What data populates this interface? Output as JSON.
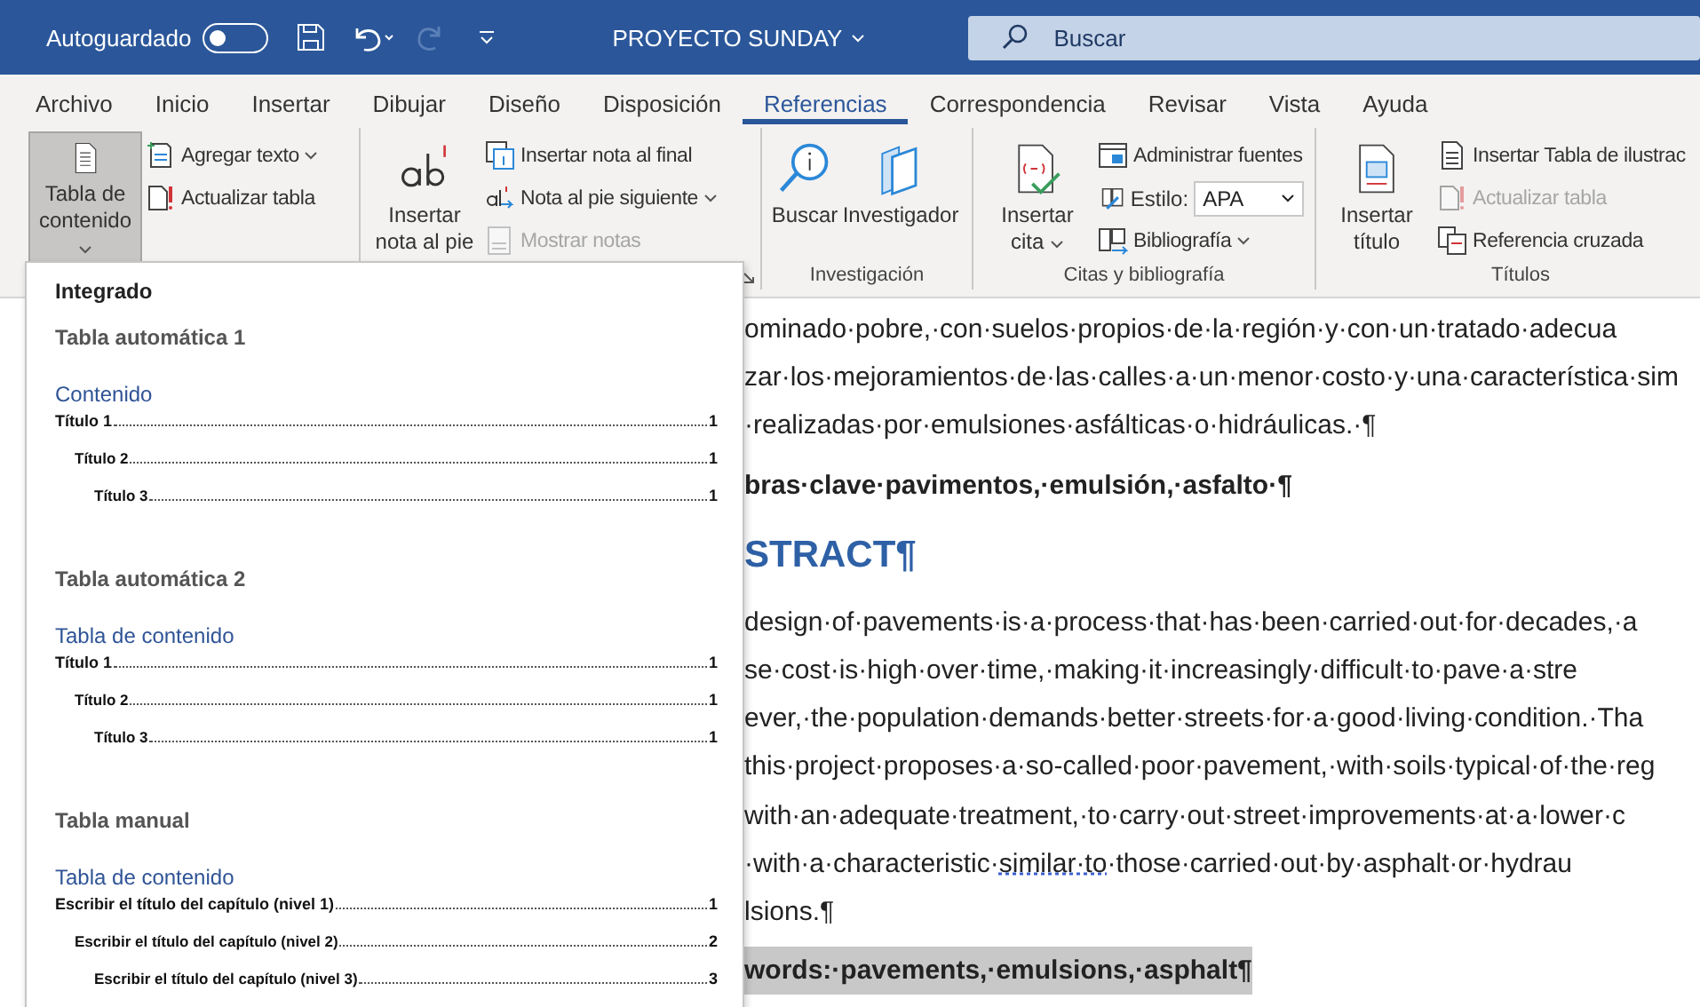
{
  "title_bar": {
    "autosave_label": "Autoguardado",
    "autosave_on": false,
    "redo_disabled": true,
    "document_title": "PROYECTO SUNDAY",
    "search": {
      "placeholder": "Buscar"
    }
  },
  "tabs": [
    {
      "label": "Archivo",
      "selected": false
    },
    {
      "label": "Inicio",
      "selected": false
    },
    {
      "label": "Insertar",
      "selected": false
    },
    {
      "label": "Dibujar",
      "selected": false
    },
    {
      "label": "Diseño",
      "selected": false
    },
    {
      "label": "Disposición",
      "selected": false
    },
    {
      "label": "Referencias",
      "selected": true
    },
    {
      "label": "Correspondencia",
      "selected": false
    },
    {
      "label": "Revisar",
      "selected": false
    },
    {
      "label": "Vista",
      "selected": false
    },
    {
      "label": "Ayuda",
      "selected": false
    }
  ],
  "ribbon": {
    "groups": [
      {
        "big": [
          {
            "label": "Tabla de contenido",
            "dropdown": true,
            "pressed": true
          }
        ],
        "small": [
          {
            "label": "Agregar texto",
            "dropdown": true,
            "disabled": false
          },
          {
            "label": "Actualizar tabla",
            "dropdown": false,
            "disabled": false
          }
        ]
      },
      {
        "launcher": true,
        "big": [
          {
            "label": "Insertar nota al pie",
            "dropdown": false,
            "pressed": false
          }
        ],
        "small": [
          {
            "label": "Insertar nota al final",
            "dropdown": false,
            "disabled": false
          },
          {
            "label": "Nota al pie siguiente",
            "dropdown": true,
            "disabled": false
          },
          {
            "label": "Mostrar notas",
            "dropdown": false,
            "disabled": true
          }
        ]
      },
      {
        "label": "Investigación",
        "big": [
          {
            "label": "Buscar",
            "dropdown": false,
            "pressed": false
          },
          {
            "label": "Investigador",
            "dropdown": false,
            "pressed": false
          }
        ]
      },
      {
        "label": "Citas y bibliografía",
        "big": [
          {
            "label": "Insertar cita",
            "dropdown": true,
            "pressed": false
          }
        ],
        "small": [
          {
            "label": "Administrar fuentes",
            "dropdown": false,
            "disabled": false
          },
          {
            "label": "Estilo:",
            "disabled": false,
            "select_value": "APA"
          },
          {
            "label": "Bibliografía",
            "dropdown": true,
            "disabled": false
          }
        ]
      },
      {
        "label": "Títulos",
        "big": [
          {
            "label": "Insertar título",
            "dropdown": false,
            "pressed": false
          }
        ],
        "small": [
          {
            "label": "Insertar Tabla de ilustrac",
            "dropdown": false,
            "disabled": false
          },
          {
            "label": "Actualizar tabla",
            "dropdown": false,
            "disabled": true
          },
          {
            "label": "Referencia cruzada",
            "dropdown": false,
            "disabled": false
          }
        ]
      }
    ]
  },
  "toc_menu": {
    "header": "Integrado",
    "sections": [
      {
        "title": "Tabla automática 1",
        "heading": "Contenido",
        "entries": [
          {
            "label": "Título 1",
            "page": "1",
            "children": [
              {
                "label": "Título 2",
                "page": "1",
                "children": [
                  {
                    "label": "Título 3",
                    "page": "1"
                  }
                ]
              }
            ]
          }
        ]
      },
      {
        "title": "Tabla automática 2",
        "heading": "Tabla de contenido",
        "entries": [
          {
            "label": "Título 1",
            "page": "1",
            "children": [
              {
                "label": "Título 2",
                "page": "1",
                "children": [
                  {
                    "label": "Título 3",
                    "page": "1"
                  }
                ]
              }
            ]
          }
        ]
      },
      {
        "title": "Tabla manual",
        "heading": "Tabla de contenido",
        "entries": [
          {
            "label": "Escribir el título del capítulo (nivel 1)",
            "page": "1",
            "children": [
              {
                "label": "Escribir el título del capítulo (nivel 2)",
                "page": "2",
                "children": [
                  {
                    "label": "Escribir el título del capítulo (nivel 3)",
                    "page": "3"
                  }
                ]
              }
            ]
          }
        ]
      }
    ]
  },
  "document": {
    "lines": [
      {
        "kind": "body",
        "segments": [
          {
            "text": "ominado·pobre,·con·suelos·propios·de·la·región·y·con·un·tratado·adecua",
            "flagged": false
          }
        ]
      },
      {
        "kind": "body",
        "segments": [
          {
            "text": "zar·los·mejoramientos·de·las·calles·a·un·menor·costo·y·una·característica·sim",
            "flagged": false
          }
        ]
      },
      {
        "kind": "body",
        "segments": [
          {
            "text": "·realizadas·por·emulsiones·asfálticas·o·hidráulicas.·¶",
            "flagged": false
          }
        ]
      },
      {
        "kind": "keywords",
        "highlighted": false,
        "segments": [
          {
            "text": "bras·clave·pavimentos,·emulsión,·asfalto·¶",
            "flagged": false
          }
        ]
      },
      {
        "kind": "heading",
        "segments": [
          {
            "text": "STRACT¶",
            "flagged": false
          }
        ]
      },
      {
        "kind": "body",
        "segments": [
          {
            "text": "design·of·pavements·is·a·process·that·has·been·carried·out·for·decades,·a",
            "flagged": false
          }
        ]
      },
      {
        "kind": "body",
        "segments": [
          {
            "text": "se·cost·is·high·over·time,·making·it·increasingly·difficult·to·pave·a·stre",
            "flagged": false
          }
        ]
      },
      {
        "kind": "body",
        "segments": [
          {
            "text": "ever,·the·population·demands·better·streets·for·a·good·living·condition.·Tha",
            "flagged": false
          }
        ]
      },
      {
        "kind": "body",
        "segments": [
          {
            "text": "this·project·proposes·a·so-called·poor·pavement,·with·soils·typical·of·the·reg",
            "flagged": false
          }
        ]
      },
      {
        "kind": "body",
        "segments": [
          {
            "text": "with·an·adequate·treatment,·to·carry·out·street·improvements·at·a·lower·c",
            "flagged": false
          }
        ]
      },
      {
        "kind": "body",
        "segments": [
          {
            "text": "·with·a·characteristic·",
            "flagged": false
          },
          {
            "text": "similar·to",
            "flagged": true
          },
          {
            "text": "·those·carried·out·by·asphalt·or·hydrau",
            "flagged": false
          }
        ]
      },
      {
        "kind": "body",
        "segments": [
          {
            "text": "lsions.¶",
            "flagged": false
          }
        ]
      },
      {
        "kind": "keywords",
        "highlighted": true,
        "segments": [
          {
            "text": "words:·pavements,·emulsions,·asphalt¶",
            "flagged": false
          }
        ]
      }
    ]
  }
}
